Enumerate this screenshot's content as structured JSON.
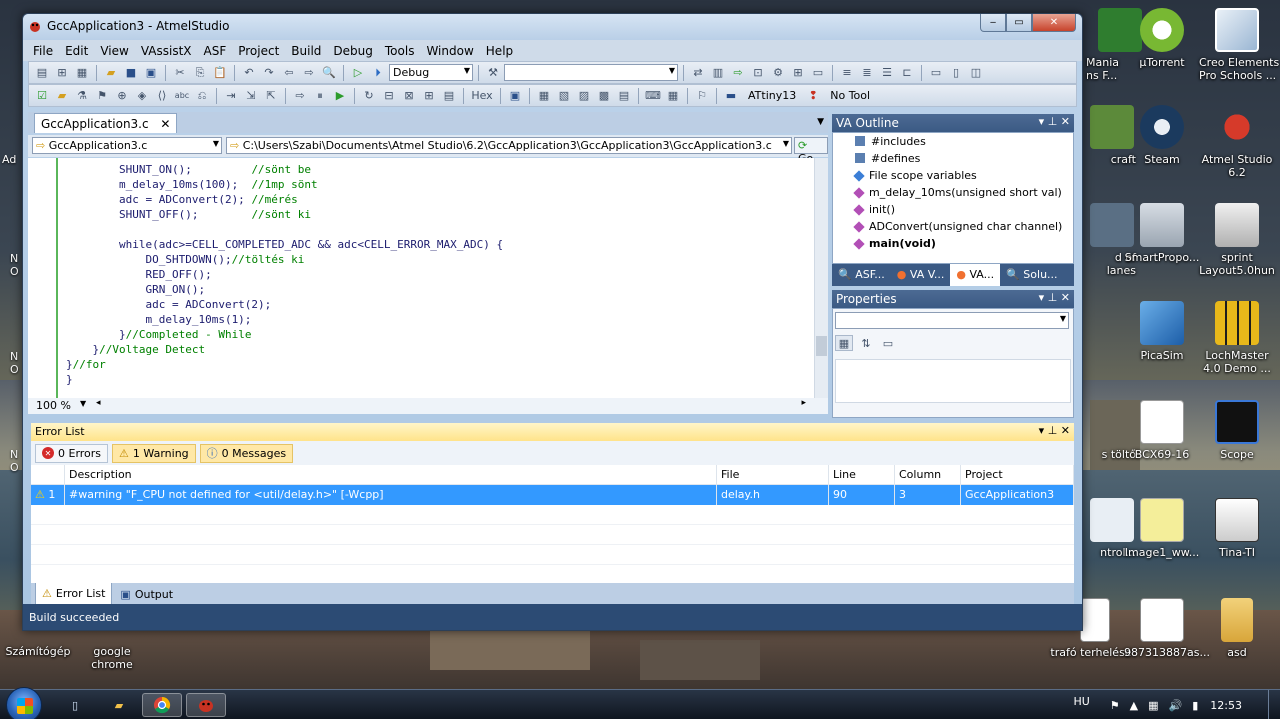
{
  "window": {
    "title": "GccApplication3 - AtmelStudio"
  },
  "menu": [
    "File",
    "Edit",
    "View",
    "VAssistX",
    "ASF",
    "Project",
    "Build",
    "Debug",
    "Tools",
    "Window",
    "Help"
  ],
  "toolbar": {
    "config_value": "Debug",
    "search_value": "",
    "hex_label": "Hex",
    "device_label": "ATtiny13",
    "tool_label": "No Tool"
  },
  "editor": {
    "tab_label": "GccApplication3.c",
    "file_combo": "GccApplication3.c",
    "path_combo": "C:\\Users\\Szabi\\Documents\\Atmel Studio\\6.2\\GccApplication3\\GccApplication3\\GccApplication3.c",
    "go_label": "Go",
    "zoom": "100 %",
    "lines": [
      {
        "code": "        SHUNT_ON();         ",
        "comment": "//sönt be"
      },
      {
        "code": "        m_delay_10ms(100);  ",
        "comment": "//1mp sönt"
      },
      {
        "code": "        adc = ADConvert(2); ",
        "comment": "//mérés"
      },
      {
        "code": "        SHUNT_OFF();        ",
        "comment": "//sönt ki"
      },
      {
        "code": "",
        "comment": ""
      },
      {
        "code": "        while(adc>=CELL_COMPLETED_ADC && adc<CELL_ERROR_MAX_ADC) {",
        "comment": ""
      },
      {
        "code": "            DO_SHTDOWN();",
        "comment": "//töltés ki"
      },
      {
        "code": "            RED_OFF();",
        "comment": ""
      },
      {
        "code": "            GRN_ON();",
        "comment": ""
      },
      {
        "code": "            adc = ADConvert(2);",
        "comment": ""
      },
      {
        "code": "            m_delay_10ms(1);",
        "comment": ""
      },
      {
        "code": "        }",
        "comment": "//Completed - While"
      },
      {
        "code": "    }",
        "comment": "//Voltage Detect"
      },
      {
        "code": "}",
        "comment": "//for"
      },
      {
        "code": "}",
        "comment": ""
      }
    ]
  },
  "va_outline": {
    "title": "VA Outline",
    "items": [
      "#includes",
      "#defines",
      "File scope variables",
      "m_delay_10ms(unsigned short val)",
      "init()",
      "ADConvert(unsigned char channel)",
      "main(void)"
    ],
    "tabs": [
      "ASF...",
      "VA V...",
      "VA...",
      "Solu..."
    ]
  },
  "properties": {
    "title": "Properties"
  },
  "error_list": {
    "title": "Error List",
    "filters": {
      "errors": "0 Errors",
      "warnings": "1 Warning",
      "messages": "0 Messages"
    },
    "columns": [
      "Description",
      "File",
      "Line",
      "Column",
      "Project"
    ],
    "rows": [
      {
        "num": "1",
        "description": "#warning \"F_CPU not defined for <util/delay.h>\" [-Wcpp]",
        "file": "delay.h",
        "line": "90",
        "column": "3",
        "project": "GccApplication3"
      }
    ],
    "tabs": [
      "Error List",
      "Output"
    ]
  },
  "status": {
    "text": "Build succeeded"
  },
  "desktop_icons": [
    {
      "label": "Mania\nns F...",
      "icon": "game-icon"
    },
    {
      "label": "µTorrent",
      "icon": "utorrent-icon"
    },
    {
      "label": "Creo Elements\nPro Schools ...",
      "icon": "creo-icon"
    },
    {
      "label": "craft",
      "icon": "minecraft-icon"
    },
    {
      "label": "Steam",
      "icon": "steam-icon"
    },
    {
      "label": "Atmel Studio\n6.2",
      "icon": "atmel-icon"
    },
    {
      "label": "d of\nlanes",
      "icon": "planes-icon"
    },
    {
      "label": "SmartPropo...",
      "icon": "smartprop-icon"
    },
    {
      "label": "sprint\nLayout5.0hun",
      "icon": "sprint-icon"
    },
    {
      "label": "PicaSim",
      "icon": "picasim-icon"
    },
    {
      "label": "LochMaster\n4.0 Demo ...",
      "icon": "lochmaster-icon"
    },
    {
      "label": "s töltő",
      "icon": "charger-icon"
    },
    {
      "label": "BCX69-16",
      "icon": "pdf-icon"
    },
    {
      "label": "Scope",
      "icon": "scope-icon"
    },
    {
      "label": "ntrol...",
      "icon": "control-icon"
    },
    {
      "label": "Image1_ww...",
      "icon": "image-icon"
    },
    {
      "label": "Tina-TI",
      "icon": "tina-icon"
    },
    {
      "label": "trafó terhelése",
      "icon": "doc-icon"
    },
    {
      "label": "987313887as...",
      "icon": "image-icon"
    },
    {
      "label": "asd",
      "icon": "folder-icon"
    },
    {
      "label": "Számítógép",
      "icon": "computer-icon"
    },
    {
      "label": "google\nchrome",
      "icon": "chrome-icon"
    }
  ],
  "left_edge_fragments": [
    "Ad",
    "N\nO",
    "N\nO",
    "N\nO"
  ],
  "taskbar": {
    "lang": "HU",
    "time": "12:53"
  }
}
